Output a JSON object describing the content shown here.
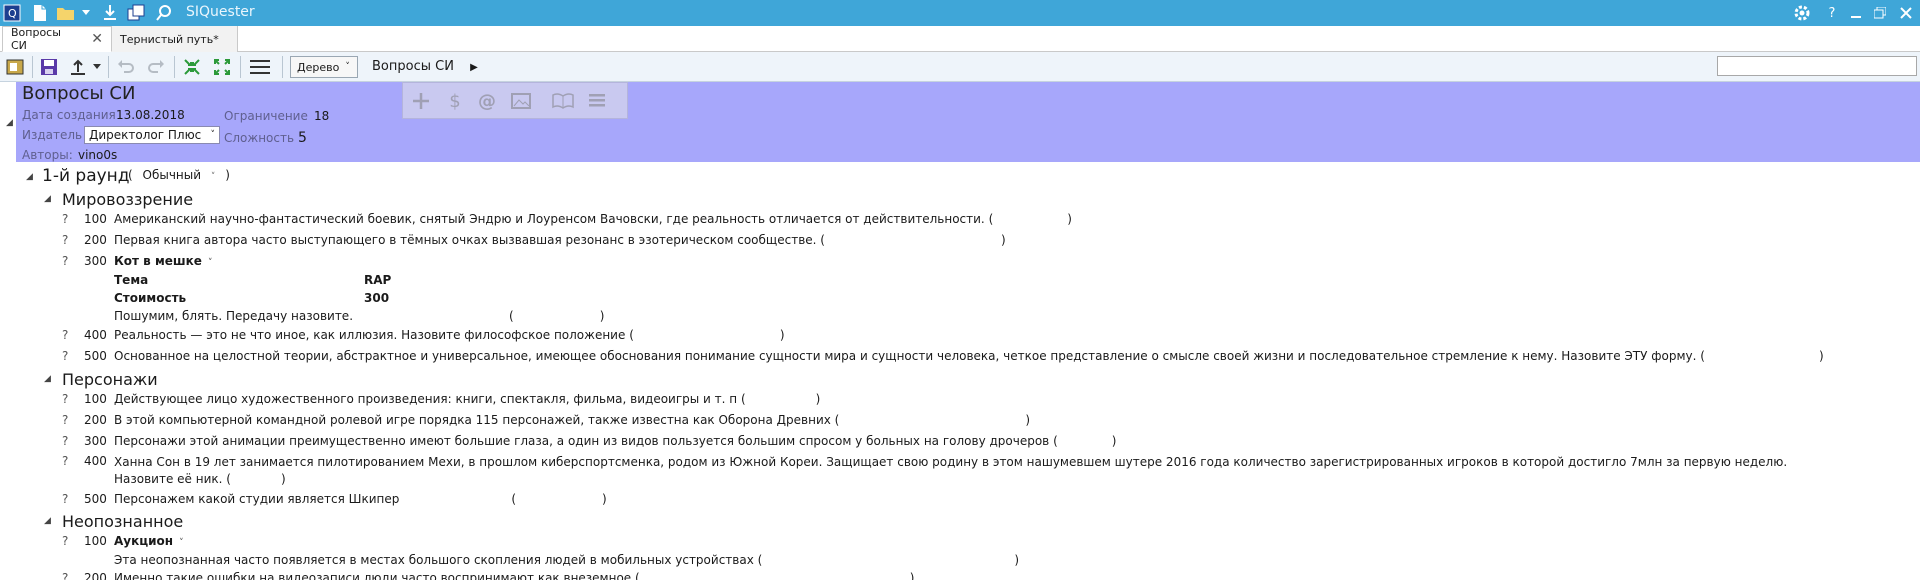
{
  "app": {
    "title": "SIQuester"
  },
  "tabs": [
    {
      "label": "Вопросы СИ"
    },
    {
      "label": "Тернистый путь*"
    }
  ],
  "toolbar": {
    "view_mode": "Дерево",
    "breadcrumb": "Вопросы СИ"
  },
  "package": {
    "title": "Вопросы СИ",
    "date_label": "Дата создания",
    "date_value": "13.08.2018",
    "restriction_label": "Ограничение",
    "restriction_value": "18",
    "publisher_label": "Издатель",
    "publisher_value": "Директолог Плюс",
    "difficulty_label": "Сложность",
    "difficulty_value": "5",
    "authors_label": "Авторы:",
    "authors_value": "vino0s"
  },
  "round": {
    "title": "1-й раунд",
    "type": "Обычный"
  },
  "themes": [
    {
      "title": "Мировоззрение",
      "questions": [
        {
          "price": "100",
          "text": "Американский научно-фантастический боевик, снятый Эндрю и Лоуренсом Вачовски, где реальность отличается от действительности."
        },
        {
          "price": "200",
          "text": "Первая книга автора часто выступающего в тёмных очках вызвавшая резонанс в эзотерическом сообществе."
        },
        {
          "price": "300",
          "special": "Кот в мешке",
          "theme_label": "Тема",
          "theme_value": "RAP",
          "cost_label": "Стоимость",
          "cost_value": "300",
          "text": "Пошумим, блять. Передачу назовите."
        },
        {
          "price": "400",
          "text": "Реальность — это не что иное, как иллюзия. Назовите философское положение"
        },
        {
          "price": "500",
          "text": "Основанное на целостной теории, абстрактное и универсальное, имеющее обоснования понимание сущности мира и сущности человека, четкое представление о смысле своей жизни и последовательное стремление к нему. Назовите ЭТУ форму."
        }
      ]
    },
    {
      "title": "Персонажи",
      "questions": [
        {
          "price": "100",
          "text": "Действующее лицо художественного произведения: книги, спектакля, фильма, видеоигры и т. п"
        },
        {
          "price": "200",
          "text": "В этой компьютерной командной ролевой игре порядка 115 персонажей, также известна как Оборона Древних"
        },
        {
          "price": "300",
          "text": "Персонажи этой анимации преимущественно имеют большие глаза, а один из видов пользуется большим спросом у больных на голову дрочеров"
        },
        {
          "price": "400",
          "text": "Ханна Сон в 19 лет занимается пилотированием Мехи, в прошлом киберспортсменка, родом из Южной Кореи. Защищает свою родину в этом нашумевшем шутере 2016 года количество зарегистрированных игроков в которой достигло 7млн за первую неделю. Назовите её ник."
        },
        {
          "price": "500",
          "text": "Персонажем какой студии является Шкипер"
        }
      ]
    },
    {
      "title": "Неопознанное",
      "questions": [
        {
          "price": "100",
          "special": "Аукцион",
          "text": "Эта неопознанная часто появляется в местах большого скопления людей в мобильных устройствах"
        },
        {
          "price": "200",
          "text": "Именно такие ошибки на видеозаписи люди часто воспринимают как внеземное"
        }
      ]
    }
  ],
  "markers": {
    "question": "?",
    "open": "(",
    "close": ")"
  }
}
